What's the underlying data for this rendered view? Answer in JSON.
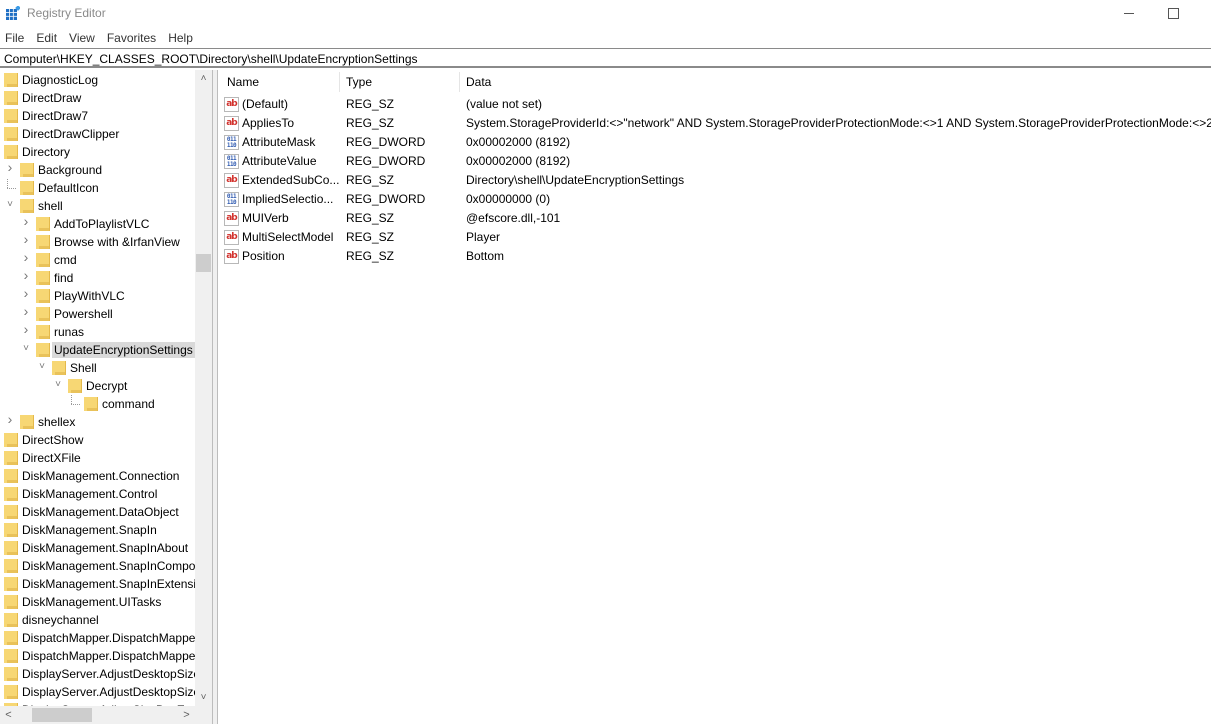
{
  "window": {
    "title": "Registry Editor",
    "app_icon": "registry-editor-icon",
    "minimize_icon": "minimize-icon",
    "maximize_icon": "maximize-icon"
  },
  "menu": [
    "File",
    "Edit",
    "View",
    "Favorites",
    "Help"
  ],
  "address": "Computer\\HKEY_CLASSES_ROOT\\Directory\\shell\\UpdateEncryptionSettings",
  "tree": [
    {
      "label": "DiagnosticLog",
      "level": 0,
      "expander": "none"
    },
    {
      "label": "DirectDraw",
      "level": 0,
      "expander": "none"
    },
    {
      "label": "DirectDraw7",
      "level": 0,
      "expander": "none"
    },
    {
      "label": "DirectDrawClipper",
      "level": 0,
      "expander": "none"
    },
    {
      "label": "Directory",
      "level": 0,
      "expander": "none"
    },
    {
      "label": "Background",
      "level": 1,
      "expander": "collapsed"
    },
    {
      "label": "DefaultIcon",
      "level": 1,
      "expander": "leaf"
    },
    {
      "label": "shell",
      "level": 1,
      "expander": "expanded"
    },
    {
      "label": "AddToPlaylistVLC",
      "level": 2,
      "expander": "collapsed"
    },
    {
      "label": "Browse with &IrfanView",
      "level": 2,
      "expander": "collapsed"
    },
    {
      "label": "cmd",
      "level": 2,
      "expander": "collapsed"
    },
    {
      "label": "find",
      "level": 2,
      "expander": "collapsed"
    },
    {
      "label": "PlayWithVLC",
      "level": 2,
      "expander": "collapsed"
    },
    {
      "label": "Powershell",
      "level": 2,
      "expander": "collapsed"
    },
    {
      "label": "runas",
      "level": 2,
      "expander": "collapsed"
    },
    {
      "label": "UpdateEncryptionSettings",
      "level": 2,
      "expander": "expanded",
      "selected": true
    },
    {
      "label": "Shell",
      "level": 3,
      "expander": "expanded"
    },
    {
      "label": "Decrypt",
      "level": 4,
      "expander": "expanded"
    },
    {
      "label": "command",
      "level": 5,
      "expander": "leaf"
    },
    {
      "label": "shellex",
      "level": 1,
      "expander": "collapsed"
    },
    {
      "label": "DirectShow",
      "level": 0,
      "expander": "none"
    },
    {
      "label": "DirectXFile",
      "level": 0,
      "expander": "none"
    },
    {
      "label": "DiskManagement.Connection",
      "level": 0,
      "expander": "none"
    },
    {
      "label": "DiskManagement.Control",
      "level": 0,
      "expander": "none"
    },
    {
      "label": "DiskManagement.DataObject",
      "level": 0,
      "expander": "none"
    },
    {
      "label": "DiskManagement.SnapIn",
      "level": 0,
      "expander": "none"
    },
    {
      "label": "DiskManagement.SnapInAbout",
      "level": 0,
      "expander": "none"
    },
    {
      "label": "DiskManagement.SnapInCompo",
      "level": 0,
      "expander": "none"
    },
    {
      "label": "DiskManagement.SnapInExtensic",
      "level": 0,
      "expander": "none"
    },
    {
      "label": "DiskManagement.UITasks",
      "level": 0,
      "expander": "none"
    },
    {
      "label": "disneychannel",
      "level": 0,
      "expander": "none"
    },
    {
      "label": "DispatchMapper.DispatchMappe",
      "level": 0,
      "expander": "none"
    },
    {
      "label": "DispatchMapper.DispatchMappe",
      "level": 0,
      "expander": "none"
    },
    {
      "label": "DisplayServer.AdjustDesktopSizeI",
      "level": 0,
      "expander": "none"
    },
    {
      "label": "DisplayServer.AdjustDesktopSizeI",
      "level": 0,
      "expander": "none"
    },
    {
      "label": "DisplayServer.AdjustSizeBoxExte",
      "level": 0,
      "expander": "none"
    }
  ],
  "columns": {
    "name": "Name",
    "type": "Type",
    "data": "Data"
  },
  "values": [
    {
      "icon": "string-value-icon",
      "kind": "sz",
      "name": "(Default)",
      "type": "REG_SZ",
      "data": "(value not set)"
    },
    {
      "icon": "string-value-icon",
      "kind": "sz",
      "name": "AppliesTo",
      "type": "REG_SZ",
      "data": "System.StorageProviderId:<>\"network\" AND System.StorageProviderProtectionMode:<>1 AND System.StorageProviderProtectionMode:<>2"
    },
    {
      "icon": "binary-value-icon",
      "kind": "dw",
      "name": "AttributeMask",
      "type": "REG_DWORD",
      "data": "0x00002000 (8192)"
    },
    {
      "icon": "binary-value-icon",
      "kind": "dw",
      "name": "AttributeValue",
      "type": "REG_DWORD",
      "data": "0x00002000 (8192)"
    },
    {
      "icon": "string-value-icon",
      "kind": "sz",
      "name": "ExtendedSubCo...",
      "type": "REG_SZ",
      "data": "Directory\\shell\\UpdateEncryptionSettings"
    },
    {
      "icon": "binary-value-icon",
      "kind": "dw",
      "name": "ImpliedSelectio...",
      "type": "REG_DWORD",
      "data": "0x00000000 (0)"
    },
    {
      "icon": "string-value-icon",
      "kind": "sz",
      "name": "MUIVerb",
      "type": "REG_SZ",
      "data": "@efscore.dll,-101"
    },
    {
      "icon": "string-value-icon",
      "kind": "sz",
      "name": "MultiSelectModel",
      "type": "REG_SZ",
      "data": "Player"
    },
    {
      "icon": "string-value-icon",
      "kind": "sz",
      "name": "Position",
      "type": "REG_SZ",
      "data": "Bottom"
    }
  ],
  "scrollbars": {
    "tree_vertical_position": 0.29,
    "tree_horizontal_position": 0.2
  },
  "glyphs": {
    "up": "˄",
    "down": "˅",
    "left": "<",
    "right": ">",
    "collapsed": "›",
    "expanded": "˅",
    "sz_icon_text": "ab",
    "dw_icon_text": "011\n110"
  }
}
